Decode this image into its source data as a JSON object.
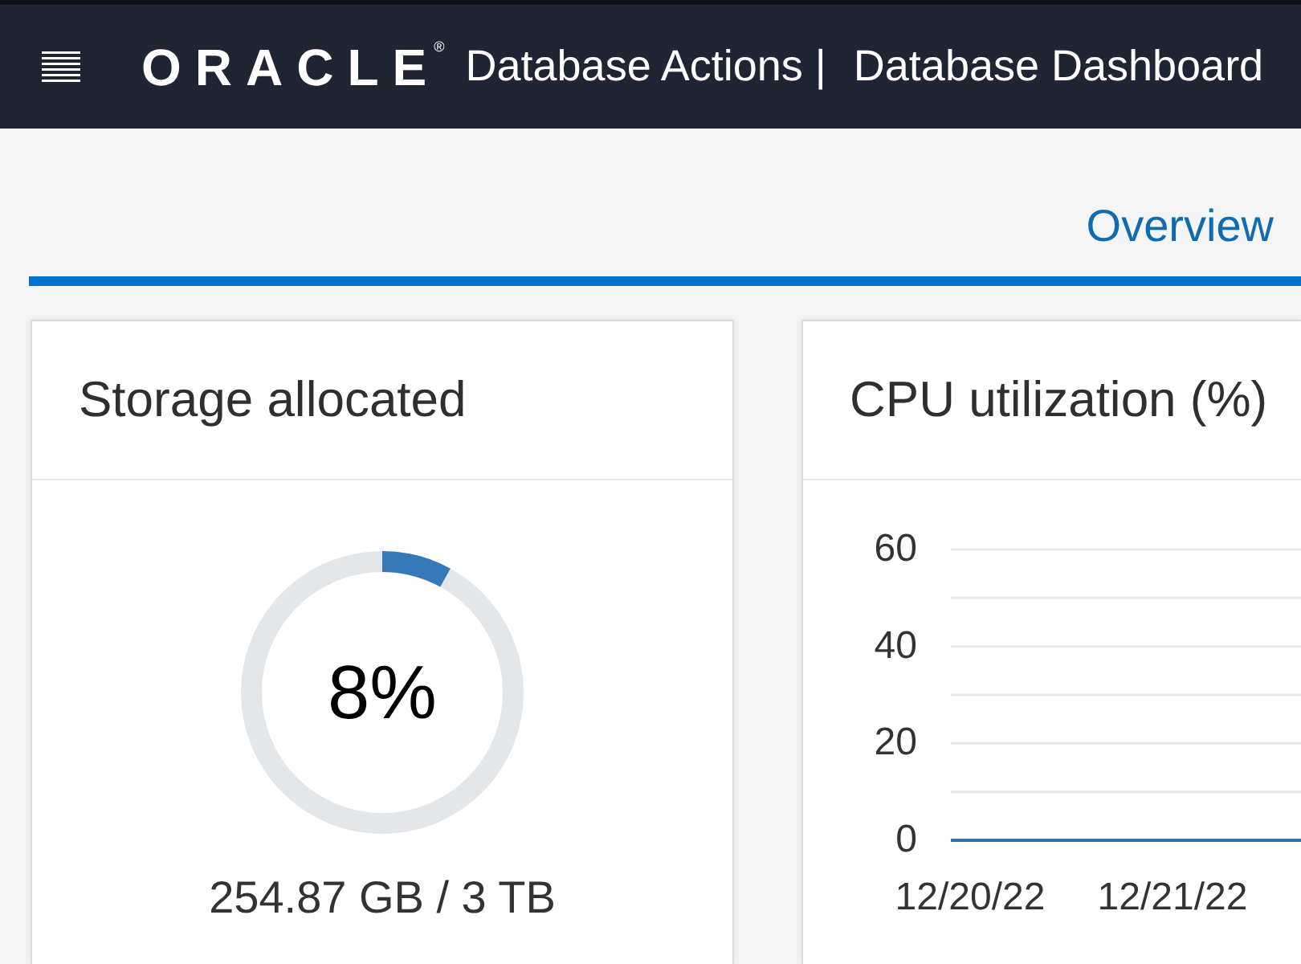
{
  "header": {
    "logo": {
      "wordmark": "ORACLE",
      "mark": "®"
    },
    "app_name": "Database Actions |",
    "page_title": "Database Dashboard"
  },
  "tabs": [
    {
      "label": "Overview",
      "selected": true
    }
  ],
  "cards": [
    {
      "kind": "gauge",
      "title": "Storage allocated",
      "level": 0.08,
      "value": "8%",
      "detail": "254.87 GB / 3 TB"
    },
    {
      "kind": "chart",
      "title": "CPU utilization (%)",
      "chart_data": {
        "type": "line",
        "categories": [
          "12/20/22",
          "12/21/22"
        ],
        "series": [
          {
            "color": "#2a72b0",
            "values": [
              0,
              0
            ]
          }
        ],
        "ylim": [
          0,
          60
        ],
        "yticks": [
          0,
          20,
          40,
          60
        ]
      }
    }
  ]
}
